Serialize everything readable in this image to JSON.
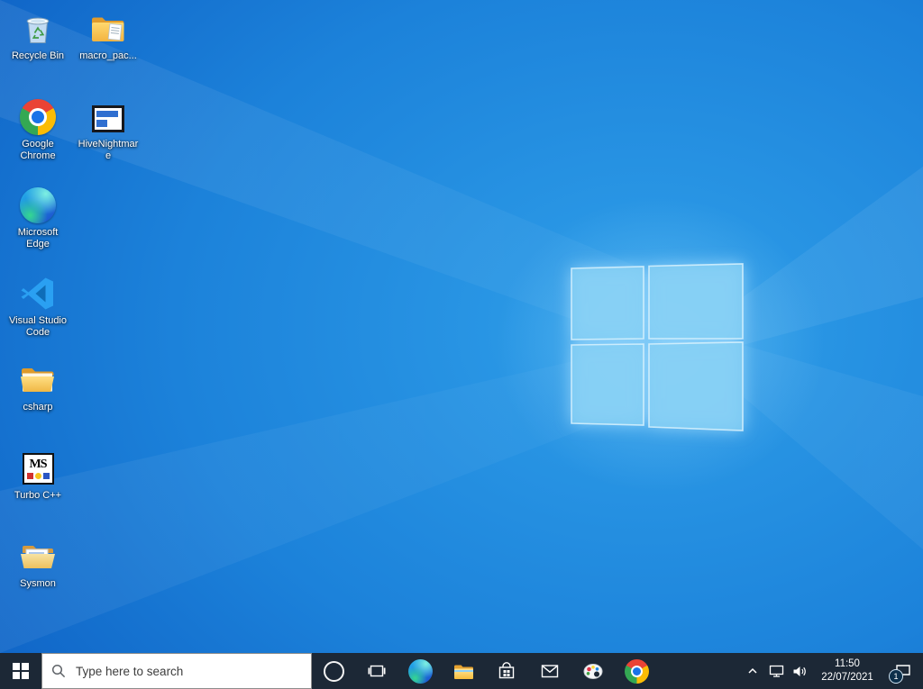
{
  "desktop": {
    "icons": [
      {
        "label": "Recycle Bin",
        "icon": "recycle-bin-icon"
      },
      {
        "label": "macro_pac...",
        "icon": "folder-document-icon"
      },
      {
        "label": "Google Chrome",
        "icon": "chrome-icon"
      },
      {
        "label": "HiveNightmare",
        "icon": "app-window-icon"
      },
      {
        "label": "Microsoft Edge",
        "icon": "edge-icon"
      },
      {
        "label": "Visual Studio Code",
        "icon": "vscode-icon"
      },
      {
        "label": "csharp",
        "icon": "folder-icon"
      },
      {
        "label": "Turbo C++",
        "icon": "msdos-icon",
        "icon_text": "MS"
      },
      {
        "label": "Sysmon",
        "icon": "folder-open-icon"
      }
    ]
  },
  "taskbar": {
    "search_placeholder": "Type here to search",
    "buttons": [
      "start",
      "search",
      "cortana",
      "task-view",
      "edge",
      "file-explorer",
      "store",
      "mail",
      "paint",
      "chrome"
    ],
    "tray_icons": [
      "hidden-icons-chevron",
      "display",
      "volume",
      "clock",
      "action-center"
    ],
    "clock": {
      "time": "11:50",
      "date": "22/07/2021"
    },
    "notification_badge": "1"
  },
  "colors": {
    "taskbar_bg": "#1c2836",
    "wallpaper_dark": "#0a50ae",
    "wallpaper_bright": "#2f9fe9",
    "logo_fill": "#86d0f4",
    "search_box_bg": "#ffffff"
  }
}
